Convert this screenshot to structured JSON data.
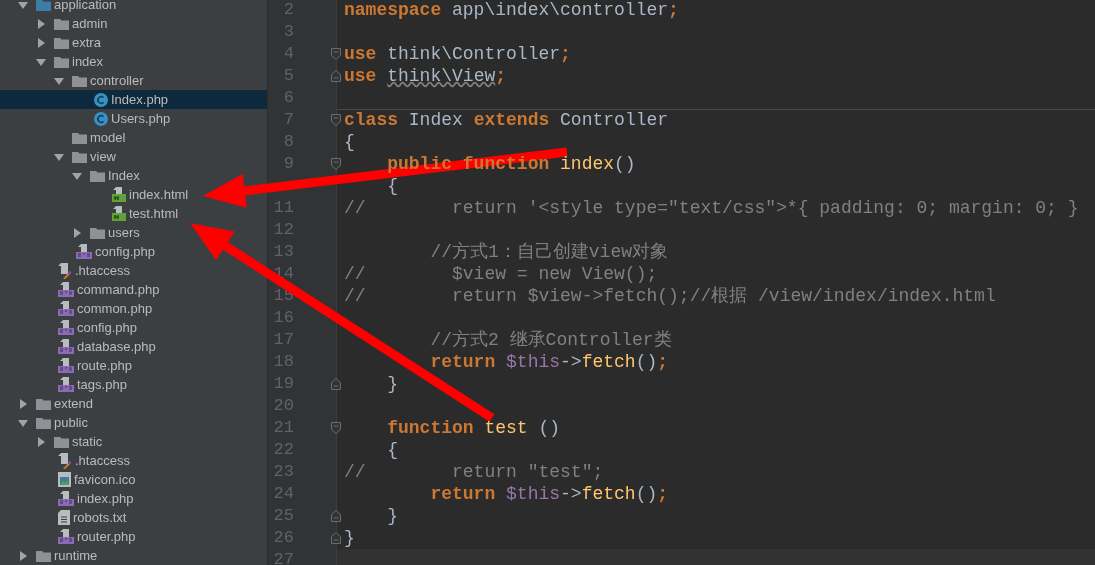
{
  "project_tree": [
    {
      "name": "application",
      "kind": "root",
      "expanded": true,
      "selected": false,
      "children": [
        {
          "name": "admin",
          "kind": "folder",
          "expanded": false,
          "selected": false
        },
        {
          "name": "extra",
          "kind": "folder",
          "expanded": false,
          "selected": false
        },
        {
          "name": "index",
          "kind": "folder",
          "expanded": true,
          "selected": false,
          "children": [
            {
              "name": "controller",
              "kind": "folder",
              "expanded": true,
              "selected": false,
              "children": [
                {
                  "name": "Index.php",
                  "kind": "class",
                  "selected": true
                },
                {
                  "name": "Users.php",
                  "kind": "class",
                  "selected": false
                }
              ]
            },
            {
              "name": "model",
              "kind": "folder",
              "selected": false
            },
            {
              "name": "view",
              "kind": "folder",
              "expanded": true,
              "selected": false,
              "children": [
                {
                  "name": "Index",
                  "kind": "folder",
                  "expanded": true,
                  "selected": false,
                  "children": [
                    {
                      "name": "index.html",
                      "kind": "html",
                      "selected": false
                    },
                    {
                      "name": "test.html",
                      "kind": "html",
                      "selected": false
                    }
                  ]
                },
                {
                  "name": "users",
                  "kind": "folder",
                  "expanded": false,
                  "selected": false
                }
              ]
            },
            {
              "name": "config.php",
              "kind": "php",
              "selected": false
            }
          ]
        },
        {
          "name": ".htaccess",
          "kind": "htaccess",
          "selected": false
        },
        {
          "name": "command.php",
          "kind": "php",
          "selected": false
        },
        {
          "name": "common.php",
          "kind": "php",
          "selected": false
        },
        {
          "name": "config.php",
          "kind": "php",
          "selected": false
        },
        {
          "name": "database.php",
          "kind": "php",
          "selected": false
        },
        {
          "name": "route.php",
          "kind": "php",
          "selected": false
        },
        {
          "name": "tags.php",
          "kind": "php",
          "selected": false
        }
      ]
    },
    {
      "name": "extend",
      "kind": "folder",
      "expanded": false,
      "selected": false
    },
    {
      "name": "public",
      "kind": "folder",
      "expanded": true,
      "selected": false,
      "children": [
        {
          "name": "static",
          "kind": "folder",
          "expanded": false,
          "selected": false
        },
        {
          "name": ".htaccess",
          "kind": "htaccess",
          "selected": false
        },
        {
          "name": "favicon.ico",
          "kind": "image",
          "selected": false
        },
        {
          "name": "index.php",
          "kind": "php",
          "selected": false
        },
        {
          "name": "robots.txt",
          "kind": "text",
          "selected": false
        },
        {
          "name": "router.php",
          "kind": "php",
          "selected": false
        }
      ]
    },
    {
      "name": "runtime",
      "kind": "folder",
      "expanded": false,
      "selected": false
    }
  ],
  "editor": {
    "lines": [
      {
        "number": "2",
        "tokens": [
          {
            "kind": "keyword",
            "text": "namespace"
          },
          {
            "kind": "plain",
            "text": " app\\index\\controller"
          },
          {
            "kind": "keyword",
            "text": ";"
          }
        ]
      },
      {
        "number": "3"
      },
      {
        "number": "4",
        "fold_open": true,
        "tokens": [
          {
            "kind": "keyword",
            "text": "use"
          },
          {
            "kind": "plain",
            "text": " think\\Controller"
          },
          {
            "kind": "keyword",
            "text": ";"
          }
        ]
      },
      {
        "number": "5",
        "fold_close": true,
        "tokens": [
          {
            "kind": "keyword",
            "text": "use "
          },
          {
            "kind": "unused",
            "text": "think\\View"
          },
          {
            "kind": "keyword",
            "text": ";"
          }
        ]
      },
      {
        "number": "6"
      },
      {
        "number": "7",
        "fold_open": true,
        "separator": true,
        "tokens": [
          {
            "kind": "keyword",
            "text": "class"
          },
          {
            "kind": "plain",
            "text": " Index "
          },
          {
            "kind": "keyword",
            "text": "extends"
          },
          {
            "kind": "plain",
            "text": " Controller"
          }
        ]
      },
      {
        "number": "8",
        "tokens": [
          {
            "kind": "plain",
            "text": "{"
          }
        ]
      },
      {
        "number": "9",
        "fold_open": true,
        "tokens": [
          {
            "kind": "keyword",
            "text": "    public function"
          },
          {
            "kind": "function",
            "text": " index"
          },
          {
            "kind": "plain",
            "text": "()"
          }
        ]
      },
      {
        "tokens": [
          {
            "kind": "plain",
            "text": "    {"
          }
        ]
      },
      {
        "number": "11",
        "tokens": [
          {
            "kind": "comment",
            "text": "//        return '<style type=\"text/css\">*{ padding: 0; margin: 0; }"
          }
        ]
      },
      {
        "number": "12"
      },
      {
        "number": "13",
        "tokens": [
          {
            "kind": "comment",
            "text": "        //方式1：自己创建view对象"
          }
        ]
      },
      {
        "number": "14",
        "tokens": [
          {
            "kind": "comment",
            "text": "//        $view = new View();"
          }
        ]
      },
      {
        "number": "15",
        "tokens": [
          {
            "kind": "comment",
            "text": "//        return $view->fetch();//根据 /view/index/index.html"
          }
        ]
      },
      {
        "number": "16"
      },
      {
        "number": "17",
        "tokens": [
          {
            "kind": "comment",
            "text": "        //方式2 继承Controller类"
          }
        ]
      },
      {
        "number": "18",
        "tokens": [
          {
            "kind": "keyword",
            "text": "        return"
          },
          {
            "kind": "variable",
            "text": " $this"
          },
          {
            "kind": "plain",
            "text": "->"
          },
          {
            "kind": "function",
            "text": "fetch"
          },
          {
            "kind": "plain",
            "text": "()"
          },
          {
            "kind": "keyword",
            "text": ";"
          }
        ]
      },
      {
        "number": "19",
        "fold_close": true,
        "tokens": [
          {
            "kind": "plain",
            "text": "    }"
          }
        ]
      },
      {
        "number": "20"
      },
      {
        "number": "21",
        "fold_open": true,
        "tokens": [
          {
            "kind": "keyword",
            "text": "    function"
          },
          {
            "kind": "function",
            "text": " test"
          },
          {
            "kind": "plain",
            "text": " ()"
          }
        ]
      },
      {
        "number": "22",
        "tokens": [
          {
            "kind": "plain",
            "text": "    {"
          }
        ]
      },
      {
        "number": "23",
        "tokens": [
          {
            "kind": "comment",
            "text": "//        return \"test\";"
          }
        ]
      },
      {
        "number": "24",
        "tokens": [
          {
            "kind": "keyword",
            "text": "        return"
          },
          {
            "kind": "variable",
            "text": " $this"
          },
          {
            "kind": "plain",
            "text": "->"
          },
          {
            "kind": "function",
            "text": "fetch"
          },
          {
            "kind": "plain",
            "text": "()"
          },
          {
            "kind": "keyword",
            "text": ";"
          }
        ]
      },
      {
        "number": "25",
        "fold_close": true,
        "tokens": [
          {
            "kind": "plain",
            "text": "    }"
          }
        ]
      },
      {
        "number": "26",
        "fold_close": true,
        "tokens": [
          {
            "kind": "plain",
            "text": "}"
          }
        ]
      },
      {
        "number": "27",
        "current": true
      }
    ]
  }
}
